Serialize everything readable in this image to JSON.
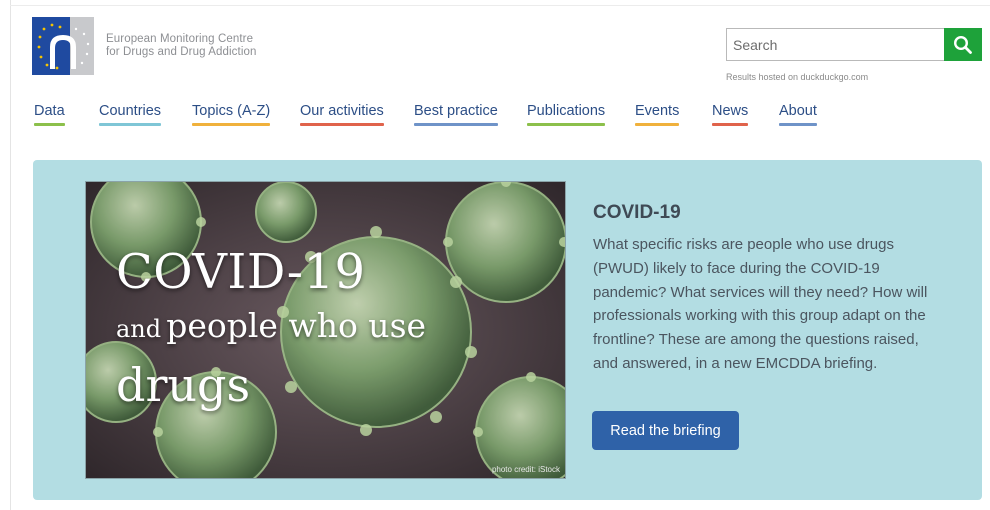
{
  "header": {
    "org_name_line1": "European Monitoring Centre",
    "org_name_line2": "for Drugs and Drug Addiction",
    "search": {
      "placeholder": "Search",
      "value": "",
      "note": "Results hosted on duckduckgo.com",
      "button_icon": "search-icon"
    }
  },
  "nav": {
    "items": [
      {
        "label": "Data",
        "color": "#8cc04b"
      },
      {
        "label": "Countries",
        "color": "#7fc6d6"
      },
      {
        "label": "Topics (A-Z)",
        "color": "#f0b13c"
      },
      {
        "label": "Our activities",
        "color": "#e0634b"
      },
      {
        "label": "Best practice",
        "color": "#6f93c8"
      },
      {
        "label": "Publications",
        "color": "#8cc04b"
      },
      {
        "label": "Events",
        "color": "#f0b13c"
      },
      {
        "label": "News",
        "color": "#e0634b"
      },
      {
        "label": "About",
        "color": "#6f93c8"
      }
    ]
  },
  "feature": {
    "image": {
      "line1": "COVID-19",
      "line2_small": "and",
      "line2_big": "people who use",
      "line3": "drugs",
      "credit": "photo credit: iStock"
    },
    "title": "COVID-19",
    "body": "What specific risks are people who use drugs (PWUD) likely to face during the COVID-19 pandemic? What services will they need? How will professionals working with this group adapt on the frontline? These are among the questions raised, and answered, in a new EMCDDA briefing.",
    "button_label": "Read the briefing",
    "background_color": "#b3dde3",
    "button_color": "#2f62a8"
  }
}
